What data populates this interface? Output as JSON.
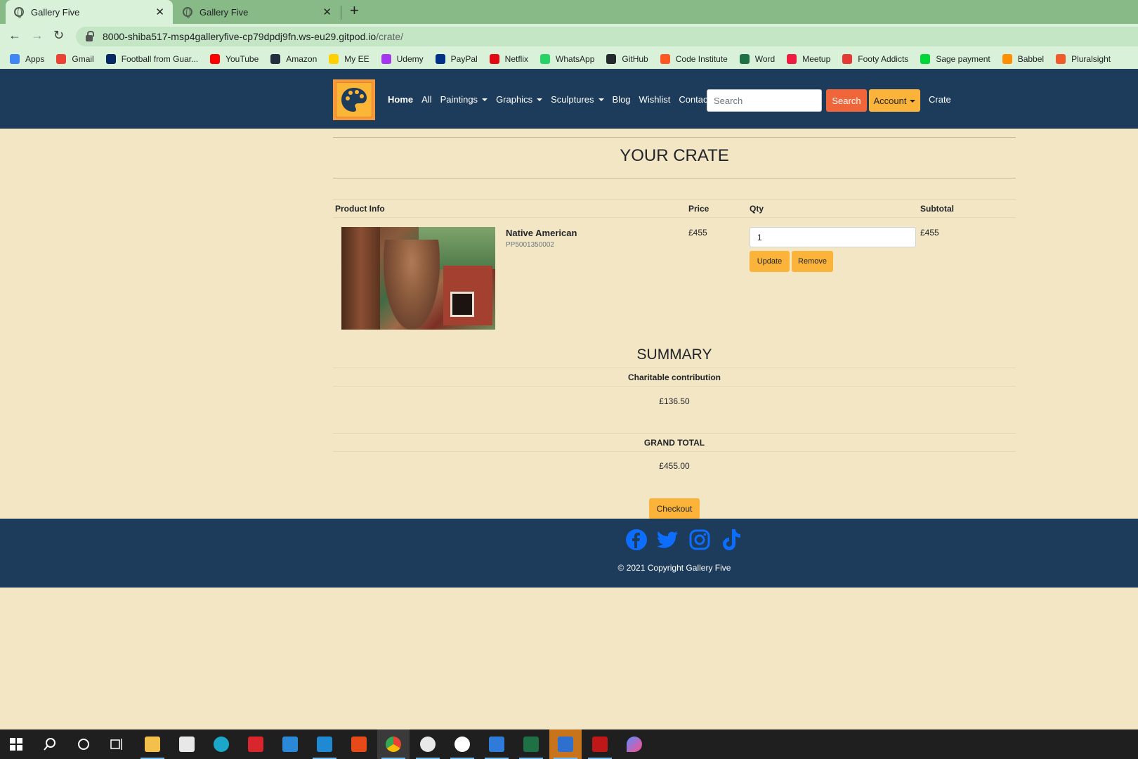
{
  "browser": {
    "tabs": [
      {
        "title": "Gallery Five",
        "active": true
      },
      {
        "title": "Gallery Five",
        "active": false
      }
    ],
    "close_glyph": "✕",
    "new_tab_glyph": "+",
    "url_host": "8000-shiba517-msp4galleryfive-cp79dpdj9fn.ws-eu29.gitpod.io",
    "url_path": "/crate/",
    "bookmarks": [
      {
        "label": "Apps",
        "color": "#4285f4"
      },
      {
        "label": "Gmail",
        "color": "#ea4335"
      },
      {
        "label": "Football from Guar...",
        "color": "#052962"
      },
      {
        "label": "YouTube",
        "color": "#ff0000"
      },
      {
        "label": "Amazon",
        "color": "#232f3e"
      },
      {
        "label": "My EE",
        "color": "#ffd100"
      },
      {
        "label": "Udemy",
        "color": "#a435f0"
      },
      {
        "label": "PayPal",
        "color": "#003087"
      },
      {
        "label": "Netflix",
        "color": "#e50914"
      },
      {
        "label": "WhatsApp",
        "color": "#25d366"
      },
      {
        "label": "GitHub",
        "color": "#24292e"
      },
      {
        "label": "Code Institute",
        "color": "#ff5722"
      },
      {
        "label": "Word",
        "color": "#1e7145"
      },
      {
        "label": "Meetup",
        "color": "#ed1c40"
      },
      {
        "label": "Footy Addicts",
        "color": "#e53935"
      },
      {
        "label": "Sage payment",
        "color": "#00d639"
      },
      {
        "label": "Babbel",
        "color": "#ff8f00"
      },
      {
        "label": "Pluralsight",
        "color": "#f15b2a"
      }
    ]
  },
  "nav": {
    "items": [
      {
        "label": "Home",
        "dropdown": false
      },
      {
        "label": "All",
        "dropdown": false
      },
      {
        "label": "Paintings",
        "dropdown": true
      },
      {
        "label": "Graphics",
        "dropdown": true
      },
      {
        "label": "Sculptures",
        "dropdown": true
      },
      {
        "label": "Blog",
        "dropdown": false
      },
      {
        "label": "Wishlist",
        "dropdown": false
      },
      {
        "label": "Contact",
        "dropdown": false
      }
    ],
    "search_placeholder": "Search",
    "search_button": "Search",
    "account_button": "Account",
    "crate_link": "Crate"
  },
  "crate": {
    "title": "YOUR CRATE",
    "headers": {
      "product": "Product Info",
      "price": "Price",
      "qty": "Qty",
      "subtotal": "Subtotal"
    },
    "item": {
      "name": "Native American",
      "sku": "PP5001350002",
      "price": "£455",
      "qty": "1",
      "subtotal": "£455",
      "update_label": "Update",
      "remove_label": "Remove"
    }
  },
  "summary": {
    "title": "SUMMARY",
    "charity_label": "Charitable contribution",
    "charity_value": "£136.50",
    "total_label": "GRAND TOTAL",
    "total_value": "£455.00",
    "checkout_label": "Checkout"
  },
  "footer": {
    "socials": [
      "facebook-icon",
      "twitter-icon",
      "instagram-icon",
      "tiktok-icon"
    ],
    "social_color": "#0d6efd",
    "copyright": "© 2021 Copyright Gallery Five"
  },
  "colors": {
    "navbar": "#1d3b5a",
    "background": "#f3e6c4",
    "accent_yellow": "#fbb33a",
    "accent_orange": "#f0663a"
  }
}
